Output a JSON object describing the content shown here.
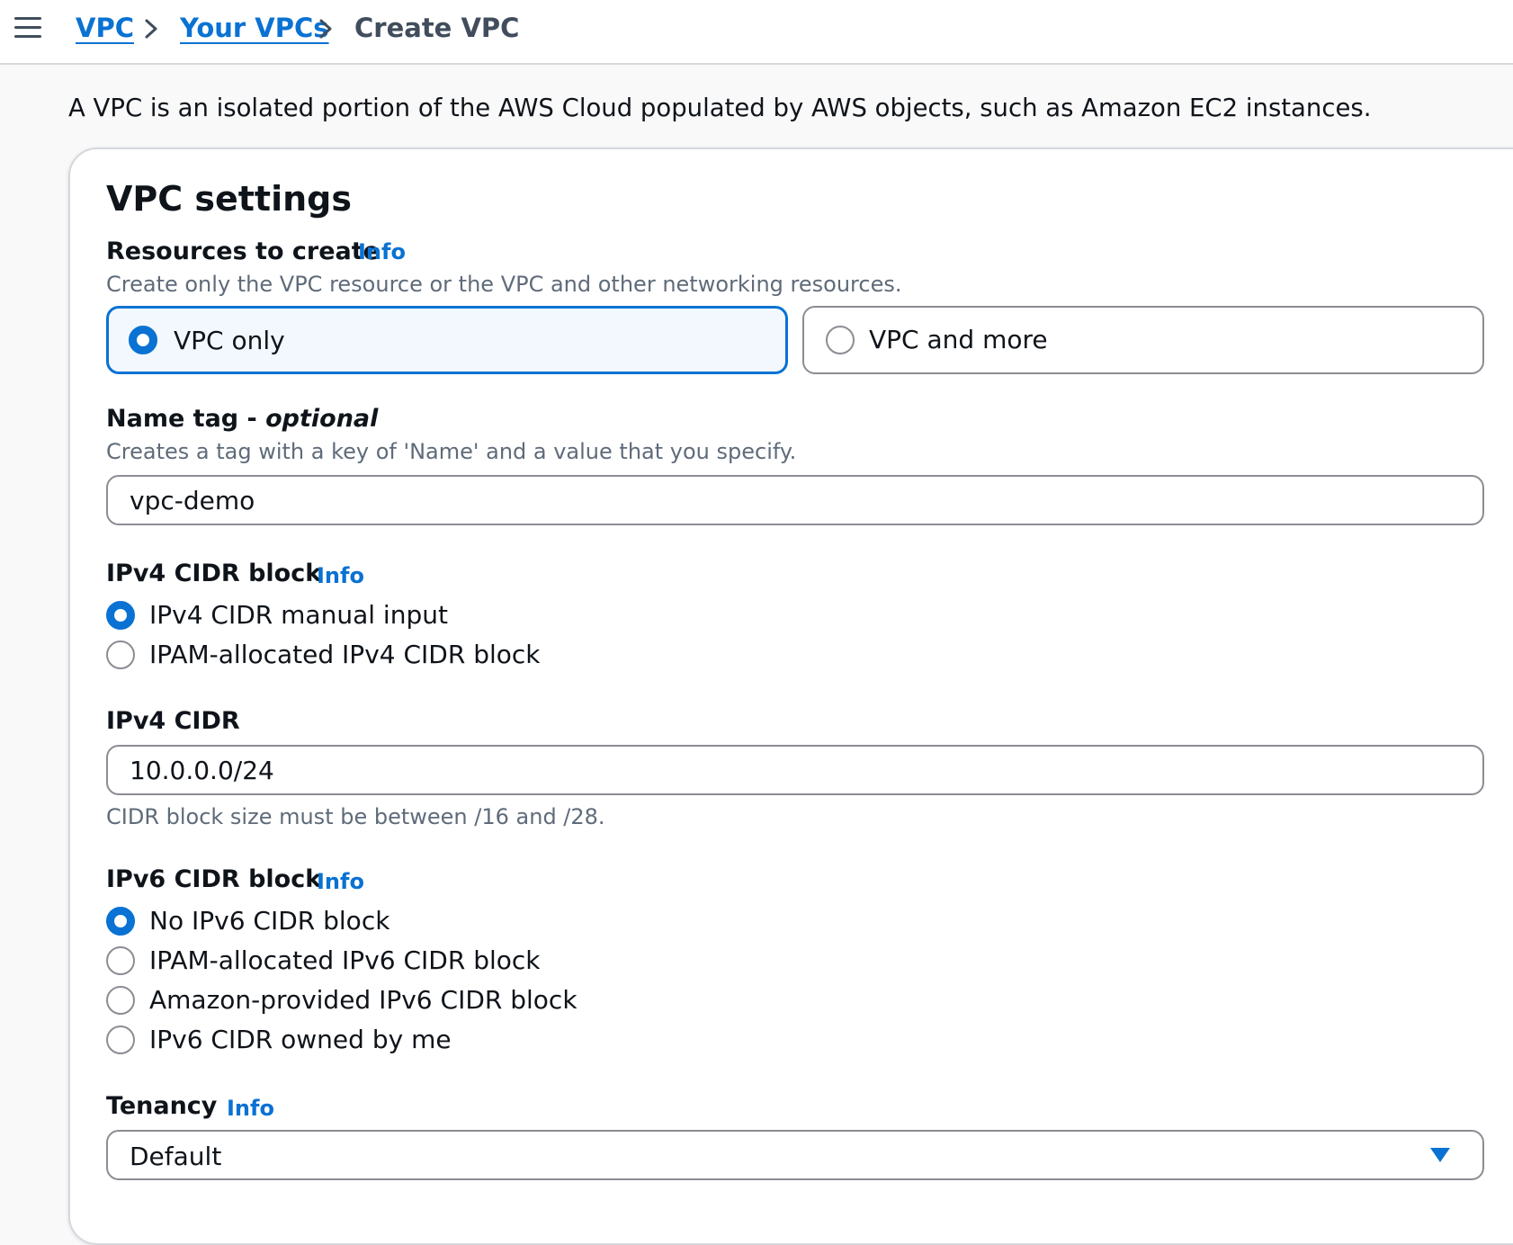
{
  "breadcrumb": {
    "items": [
      {
        "label": "VPC"
      },
      {
        "label": "Your VPCs"
      },
      {
        "label": "Create VPC"
      }
    ]
  },
  "intro": "A VPC is an isolated portion of the AWS Cloud populated by AWS objects, such as Amazon EC2 instances.",
  "settings": {
    "title": "VPC settings",
    "resources": {
      "label": "Resources to create",
      "info": "Info",
      "description": "Create only the VPC resource or the VPC and other networking resources.",
      "options": [
        {
          "label": "VPC only",
          "selected": true
        },
        {
          "label": "VPC and more",
          "selected": false
        }
      ]
    },
    "name_tag": {
      "label": "Name tag - ",
      "label_suffix": "optional",
      "description": "Creates a tag with a key of 'Name' and a value that you specify.",
      "value": "vpc-demo"
    },
    "ipv4_block": {
      "label": "IPv4 CIDR block",
      "info": "Info",
      "options": [
        {
          "label": "IPv4 CIDR manual input",
          "selected": true
        },
        {
          "label": "IPAM-allocated IPv4 CIDR block",
          "selected": false
        }
      ]
    },
    "ipv4_cidr": {
      "label": "IPv4 CIDR",
      "value": "10.0.0.0/24",
      "hint": "CIDR block size must be between /16 and /28."
    },
    "ipv6_block": {
      "label": "IPv6 CIDR block",
      "info": "Info",
      "options": [
        {
          "label": "No IPv6 CIDR block",
          "selected": true
        },
        {
          "label": "IPAM-allocated IPv6 CIDR block",
          "selected": false
        },
        {
          "label": "Amazon-provided IPv6 CIDR block",
          "selected": false
        },
        {
          "label": "IPv6 CIDR owned by me",
          "selected": false
        }
      ]
    },
    "tenancy": {
      "label": "Tenancy",
      "info": "Info",
      "value": "Default"
    }
  },
  "colors": {
    "accent": "#0972d3",
    "text": "#0f141a",
    "muted": "#5f6b7a",
    "border": "#8c8c94"
  },
  "icons": {
    "menu": "menu-icon",
    "chevron": "chevron-right-icon",
    "caret": "caret-down-icon"
  }
}
